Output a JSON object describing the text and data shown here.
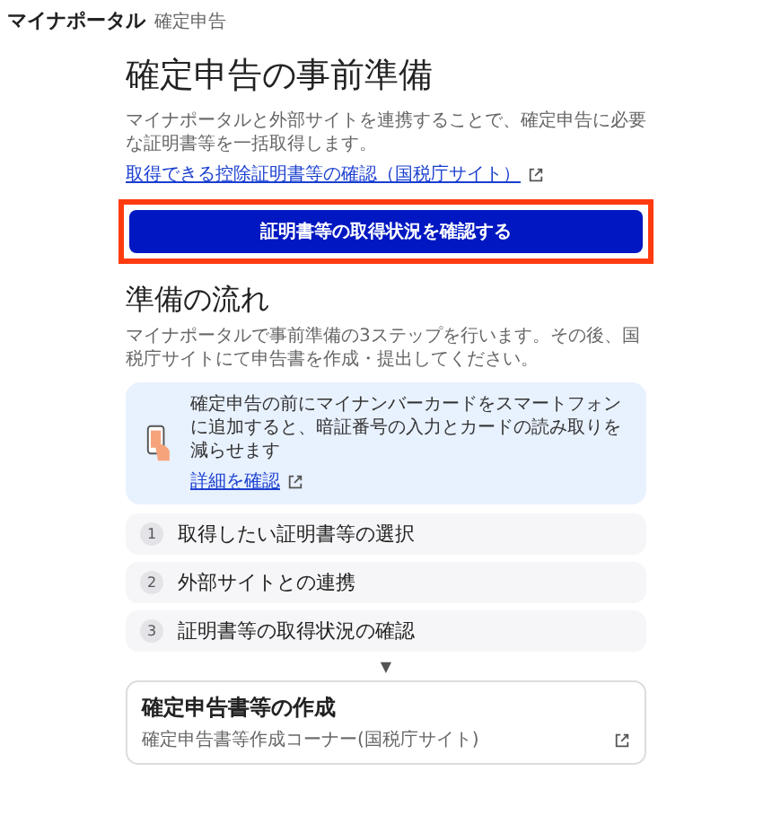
{
  "header": {
    "logo": "マイナポータル",
    "section": "確定申告"
  },
  "title": "確定申告の事前準備",
  "intro": "マイナポータルと外部サイトを連携することで、確定申告に必要な証明書等を一括取得します。",
  "intro_link": "取得できる控除証明書等の確認（国税庁サイト）",
  "primary_button": {
    "label": "証明書等の取得状況を確認する",
    "highlighted": true
  },
  "flow": {
    "heading": "準備の流れ",
    "description": "マイナポータルで事前準備の3ステップを行います。その後、国税庁サイトにて申告書を作成・提出してください。"
  },
  "notice": {
    "text": "確定申告の前にマイナンバーカードをスマートフォンに追加すると、暗証番号の入力とカードの読み取りを減らせます",
    "link": "詳細を確認"
  },
  "steps": [
    {
      "number": "1",
      "label": "取得したい証明書等の選択"
    },
    {
      "number": "2",
      "label": "外部サイトとの連携"
    },
    {
      "number": "3",
      "label": "証明書等の取得状況の確認"
    }
  ],
  "arrow": "▼",
  "final_card": {
    "title": "確定申告書等の作成",
    "subtitle": "確定申告書等作成コーナー(国税庁サイト)"
  }
}
